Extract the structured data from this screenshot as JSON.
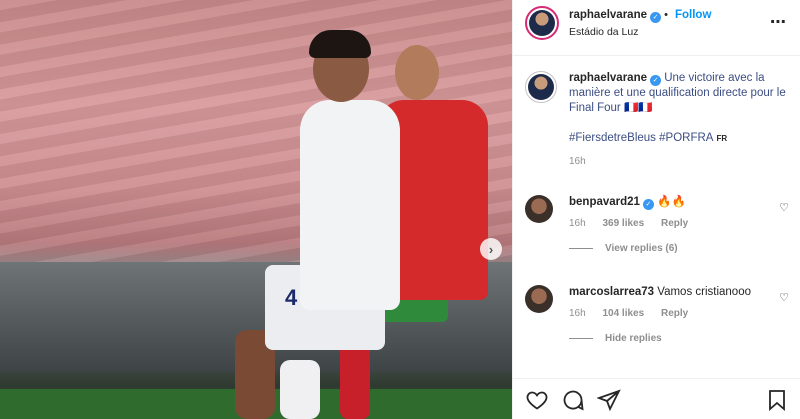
{
  "post": {
    "username": "raphaelvarane",
    "verified": true,
    "follow_label": "Follow",
    "location": "Estádio da Luz",
    "more_icon": "more-options-icon",
    "shirt_number": "4",
    "next_icon": "chevron-right-icon"
  },
  "caption": {
    "username": "raphaelvarane",
    "text": "Une victoire avec la manière et une qualification directe pour le Final Four 🇫🇷🇫🇷",
    "hashtags": "#FiersdetreBleus #PORFRA",
    "lang_badge": "FR",
    "time": "16h"
  },
  "comments": [
    {
      "username": "benpavard21",
      "text": "🔥🔥",
      "time": "16h",
      "likes": "369 likes",
      "reply_label": "Reply",
      "replies_label": "View replies (6)"
    },
    {
      "username": "marcoslarrea73",
      "text": "Vamos cristianooo",
      "time": "16h",
      "likes": "104 likes",
      "reply_label": "Reply",
      "replies_label": "Hide replies"
    }
  ],
  "actions": {
    "like_icon": "heart-icon",
    "comment_icon": "comment-icon",
    "share_icon": "share-icon",
    "save_icon": "bookmark-icon"
  },
  "colors": {
    "link_blue": "#0095f6",
    "caption_text": "#3b4d84",
    "secondary_text": "#8e8e8e"
  }
}
